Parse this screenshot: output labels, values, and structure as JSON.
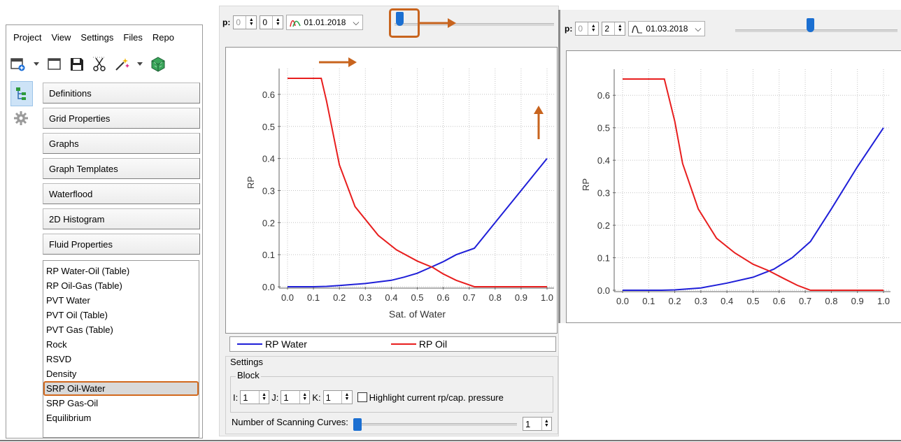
{
  "menu": {
    "items": [
      "Project",
      "View",
      "Settings",
      "Files",
      "Repo"
    ]
  },
  "toolbar": {
    "icons": [
      "new-window-icon",
      "dropdown-arrow-icon",
      "window-icon",
      "save-icon",
      "cut-icon",
      "magic-wand-icon",
      "dropdown-arrow-icon",
      "cube-icon"
    ]
  },
  "side_tabs": [
    {
      "icon": "tree-icon"
    },
    {
      "icon": "gear-icon"
    }
  ],
  "categories": [
    "Definitions",
    "Grid Properties",
    "Graphs",
    "Graph Templates",
    "Waterflood",
    "2D Histogram",
    "Fluid Properties"
  ],
  "fluid_list": {
    "items": [
      "RP Water-Oil (Table)",
      "RP Oil-Gas (Table)",
      "PVT Water",
      "PVT Oil (Table)",
      "PVT Gas (Table)",
      "Rock",
      "RSVD",
      "Density",
      "SRP Oil-Water",
      "SRP Gas-Oil",
      "Equilibrium"
    ],
    "selected": "SRP Oil-Water"
  },
  "left_graph": {
    "step_label": "p:",
    "spin_a": "0",
    "spin_b": "0",
    "date": "01.01.2018",
    "slider_level": 0.0
  },
  "right_graph": {
    "step_label": "p:",
    "spin_a": "0",
    "spin_b": "2",
    "date": "01.03.2018",
    "slider_level": 0.5
  },
  "legend": {
    "water": "RP Water",
    "oil": "RP Oil"
  },
  "settings": {
    "title": "Settings",
    "block_title": "Block",
    "i_label": "I:",
    "i_value": "1",
    "j_label": "J:",
    "j_value": "1",
    "k_label": "K:",
    "k_value": "1",
    "highlight_label": "Highlight current rp/cap. pressure",
    "scanning_label": "Number of Scanning Curves:",
    "scanning_value": "1"
  },
  "colors": {
    "water": "#1f1fd8",
    "oil": "#e81e1e",
    "annotation": "#c8641e",
    "slider": "#1b6fd1"
  },
  "chart_data": [
    {
      "type": "line",
      "xlabel": "Sat. of Water",
      "ylabel": "RP",
      "xlim": [
        0.0,
        1.0
      ],
      "ylim": [
        0.0,
        0.65
      ],
      "x_ticks": [
        "0.0",
        "0.1",
        "0.2",
        "0.3",
        "0.4",
        "0.5",
        "0.6",
        "0.7",
        "0.8",
        "0.9",
        "1.0"
      ],
      "y_ticks": [
        "0.0",
        "0.1",
        "0.2",
        "0.3",
        "0.4",
        "0.5",
        "0.6"
      ],
      "grid": true,
      "legend": "bottom",
      "series": [
        {
          "name": "RP Water",
          "x": [
            0.0,
            0.1,
            0.15,
            0.2,
            0.3,
            0.4,
            0.45,
            0.5,
            0.55,
            0.6,
            0.65,
            0.72,
            0.8,
            0.9,
            1.0
          ],
          "y": [
            0.0,
            0.0,
            0.001,
            0.004,
            0.01,
            0.02,
            0.03,
            0.042,
            0.06,
            0.078,
            0.1,
            0.12,
            0.2,
            0.3,
            0.4
          ]
        },
        {
          "name": "RP Oil",
          "x": [
            0.0,
            0.13,
            0.15,
            0.2,
            0.26,
            0.35,
            0.42,
            0.5,
            0.56,
            0.6,
            0.65,
            0.72,
            0.8,
            0.9,
            1.0
          ],
          "y": [
            0.65,
            0.65,
            0.58,
            0.38,
            0.25,
            0.16,
            0.115,
            0.08,
            0.06,
            0.04,
            0.02,
            0.0,
            0.0,
            0.0,
            0.0
          ]
        }
      ]
    },
    {
      "type": "line",
      "xlabel": "",
      "ylabel": "RP",
      "xlim": [
        0.0,
        1.0
      ],
      "ylim": [
        0.0,
        0.65
      ],
      "x_ticks": [
        "0.0",
        "0.1",
        "0.2",
        "0.3",
        "0.4",
        "0.5",
        "0.6",
        "0.7",
        "0.8",
        "0.9",
        "1.0"
      ],
      "y_ticks": [
        "0.0",
        "0.1",
        "0.2",
        "0.3",
        "0.4",
        "0.5",
        "0.6"
      ],
      "grid": true,
      "series": [
        {
          "name": "RP Water",
          "x": [
            0.0,
            0.15,
            0.2,
            0.3,
            0.4,
            0.5,
            0.58,
            0.65,
            0.72,
            0.8,
            0.9,
            1.0
          ],
          "y": [
            0.0,
            0.0,
            0.001,
            0.007,
            0.022,
            0.04,
            0.065,
            0.1,
            0.15,
            0.25,
            0.38,
            0.5
          ]
        },
        {
          "name": "RP Oil",
          "x": [
            0.0,
            0.16,
            0.2,
            0.23,
            0.29,
            0.36,
            0.43,
            0.5,
            0.56,
            0.62,
            0.67,
            0.72,
            0.8,
            0.9,
            1.0
          ],
          "y": [
            0.65,
            0.65,
            0.52,
            0.39,
            0.25,
            0.16,
            0.115,
            0.08,
            0.06,
            0.035,
            0.015,
            0.0,
            0.0,
            0.0,
            0.0
          ]
        }
      ]
    }
  ]
}
